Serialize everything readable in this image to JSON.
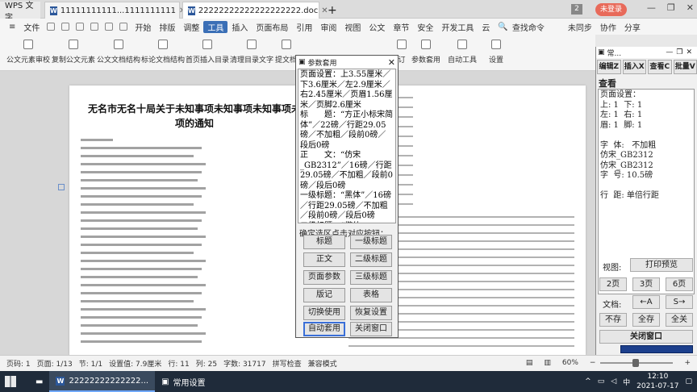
{
  "titlebar": {
    "app": "WPS 文字",
    "tabs": [
      {
        "label": "11111111111...1111111111"
      },
      {
        "label": "22222222222222222222.doc"
      }
    ],
    "new_tab": "+",
    "badge": "2",
    "login": "未登录"
  },
  "menubar": {
    "file": "文件",
    "items": [
      "开始",
      "插入",
      "页面布局",
      "引用",
      "审阅",
      "视图",
      "章节",
      "安全",
      "开发工具",
      "云"
    ],
    "active": "工具",
    "layout_label": "排版",
    "adjust_label": "调整",
    "public_label": "公文",
    "search": "查找命令",
    "sync": "未同步",
    "collab": "协作",
    "share": "分享"
  },
  "ribbon": {
    "items": [
      "公文元素审校",
      "复制公文元素",
      "公文文档结构",
      "标论文档结构",
      "首页插入目录",
      "清理目录文字",
      "提文档",
      "订",
      "参数套用",
      "自动工具",
      "设置"
    ]
  },
  "document": {
    "title_line1": "无名市无名十局关于未知事项未知事项未知事项未",
    "title_line2": "项的通知"
  },
  "statusbar": {
    "page_code": "页码: 1",
    "pages": "页面: 1/13",
    "section": "节: 1/1",
    "setting": "设置值: 7.9厘米",
    "row": "行: 11",
    "col": "列: 25",
    "words": "字数: 31717",
    "spell": "拼写检查",
    "compat": "兼容模式",
    "zoom": "60%"
  },
  "taskbar": {
    "items": [
      {
        "label": "22222222222222..."
      },
      {
        "label": "常用设置"
      }
    ],
    "time": "12:10",
    "date": "2021-07-17",
    "lang": "中"
  },
  "dialog": {
    "title": "参数套用",
    "content": "页面设置：上3.55厘米／下3.6厘米／左2.9厘米／右2.45厘米／页眉1.56厘米／页脚2.6厘米\n标　　题：“方正小标宋简体”／22磅／行距29.05磅／不加粗／段前0磅／段后0磅\n正　　文：“仿宋_GB2312”／16磅／行距29.05磅／不加粗／段前0磅／段后0磅\n一级标题：“黑体”／16磅／行距29.05磅／不加粗／段前0磅／段后0磅\n二级标题：“楷体_GB2312”／16磅／行距",
    "prompt": "确定选区点击对应按钮：",
    "buttons": [
      "标题",
      "一级标题",
      "正文",
      "二级标题",
      "页面参数",
      "三级标题",
      "版记",
      "表格",
      "切换使用",
      "恢复设置",
      "自动套用",
      "关闭窗口"
    ]
  },
  "sidepanel": {
    "title": "常...",
    "buttons": [
      "编辑Z",
      "插入X",
      "查看C",
      "批量V"
    ],
    "section": "查看",
    "content": "页面设置：\n上: 1  下: 1\n左: 1  右: 1\n眉: 1  脚: 1\n\n字  体:   不加粗\n仿宋_GB2312\n仿宋_GB2312\n字  号: 10.5磅\n\n行  距: 单倍行距",
    "view_label": "视图:",
    "print_preview": "打印预览",
    "p2": "2页",
    "p3": "3页",
    "p6": "6页",
    "doc_label": "文档:",
    "prev": "←A",
    "next": "S→",
    "nosave": "不存",
    "saveall": "全存",
    "closeall": "全关",
    "close_window": "关闭窗口"
  }
}
